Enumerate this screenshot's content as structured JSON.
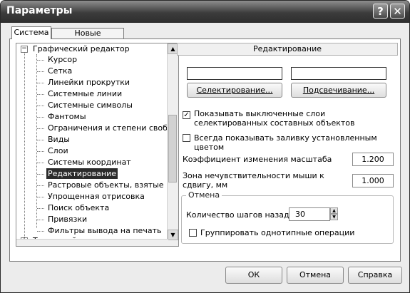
{
  "window": {
    "title": "Параметры",
    "help_btn": "?",
    "close_btn": "✕"
  },
  "tabs": [
    {
      "label": "Система",
      "active": true
    },
    {
      "label": "Новые документы",
      "active": false
    }
  ],
  "tree": {
    "root": "Графический редактор",
    "root_expander": "−",
    "items": [
      "Курсор",
      "Сетка",
      "Линейки прокрутки",
      "Системные линии",
      "Системные символы",
      "Фантомы",
      "Ограничения и степени свободы",
      "Виды",
      "Слои",
      "Системы координат",
      "Редактирование",
      "Растровые объекты, взятые в документ",
      "Упрощенная отрисовка",
      "Поиск объекта",
      "Привязки",
      "Фильтры вывода на печать"
    ],
    "selected_index": 10,
    "next_root": "Текстовый редактор",
    "next_root_expander": "+"
  },
  "panel": {
    "header": "Редактирование",
    "select_button": "Селектирование...",
    "highlight_button": "Подсвечивание...",
    "show_disabled_layers": {
      "label": "Показывать выключенные слои селектированных составных объектов",
      "checked": true,
      "mark": "✓"
    },
    "always_fill": {
      "label": "Всегда показывать заливку установленным цветом",
      "checked": false
    },
    "scale_coef": {
      "label": "Коэффициент изменения масштаба",
      "value": "1.200"
    },
    "mouse_zone": {
      "label": "Зона нечувствительности мыши к сдвигу, мм",
      "value": "1.000"
    },
    "undo_group": {
      "legend": "Отмена",
      "steps_label": "Количество шагов назад",
      "steps_value": "30",
      "group_same": {
        "label": "Группировать однотипные операции",
        "checked": false
      }
    }
  },
  "footer": {
    "ok": "ОК",
    "cancel": "Отмена",
    "help": "Справка"
  },
  "colors": {
    "selection": "#2b2b2b",
    "titlebar": "#3c3c3c"
  }
}
